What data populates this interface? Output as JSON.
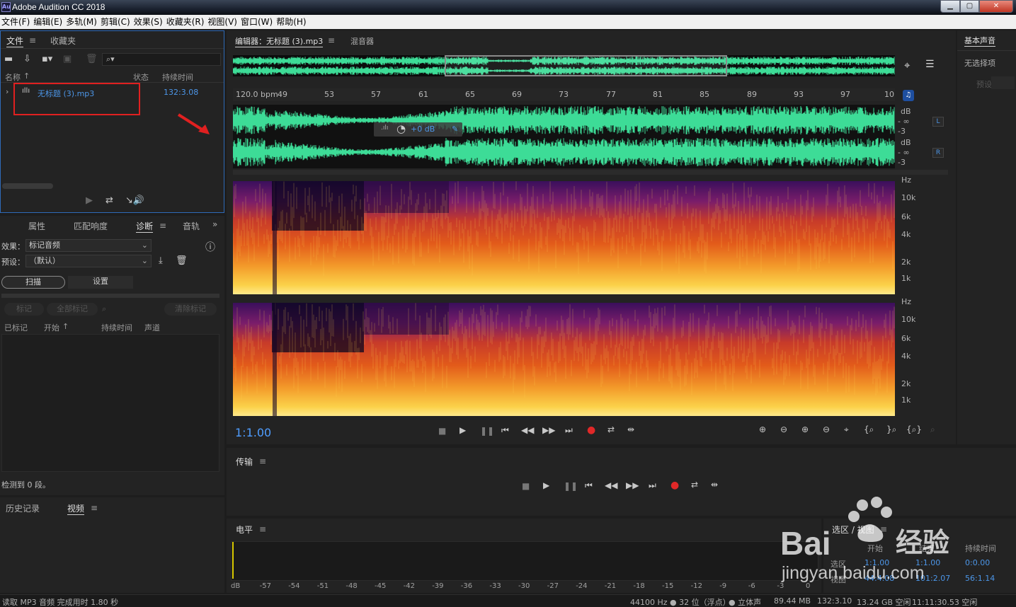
{
  "window": {
    "title": "Adobe Audition CC 2018",
    "logo": "Au"
  },
  "menu": [
    "文件(F)",
    "编辑(E)",
    "多轨(M)",
    "剪辑(C)",
    "效果(S)",
    "收藏夹(R)",
    "视图(V)",
    "窗口(W)",
    "帮助(H)"
  ],
  "files_panel": {
    "tabs": [
      "文件",
      "收藏夹"
    ],
    "columns": {
      "name": "名称",
      "status": "状态",
      "duration": "持续时间"
    },
    "file": {
      "name": "无标题 (3).mp3",
      "duration": "132:3.08"
    }
  },
  "diag_panel": {
    "tabs": [
      "属性",
      "匹配响度",
      "诊断",
      "音轨"
    ],
    "effect_label": "效果：",
    "effect_value": "标记音频",
    "preset_label": "预设：",
    "preset_value": "（默认）",
    "scan_btn": "扫描",
    "settings_btn": "设置",
    "mark_btn": "标记",
    "mark_all_btn": "全部标记",
    "clear_marks_btn": "清除标记",
    "cols": [
      "已标记",
      "开始",
      "持续时间",
      "声道"
    ],
    "detected": "检测到 0 段。"
  },
  "hist_panel": {
    "tabs": [
      "历史记录",
      "视频"
    ]
  },
  "editor": {
    "tab_editor": "编辑器：无标题 (3).mp3",
    "tab_mixer": "混音器",
    "bpm": "120.0 bpm",
    "ruler": [
      "49",
      "53",
      "57",
      "61",
      "65",
      "69",
      "73",
      "77",
      "81",
      "85",
      "89",
      "93",
      "97",
      "10"
    ],
    "hud_gain": "+0 dB",
    "db": "dB",
    "db_inf": "- ∞",
    "db_m3": "-3",
    "ch_l": "L",
    "ch_r": "R",
    "hz": "Hz",
    "freqs": [
      "10k",
      "6k",
      "4k",
      "2k",
      "1k"
    ],
    "timecode": "1:1.00"
  },
  "right_panel": {
    "title": "基本声音",
    "none": "无选择项",
    "preset": "预设："
  },
  "transport": {
    "title": "传输"
  },
  "level": {
    "title": "电平",
    "scale": [
      "dB",
      "-57",
      "-54",
      "-51",
      "-48",
      "-45",
      "-42",
      "-39",
      "-36",
      "-33",
      "-30",
      "-27",
      "-24",
      "-21",
      "-18",
      "-15",
      "-12",
      "-9",
      "-6",
      "-3",
      "0"
    ]
  },
  "selection": {
    "title": "选区 / 视图",
    "col_start": "开始",
    "col_end": "结束",
    "col_dur": "持续时间",
    "row_sel": "选区",
    "row_view": "视图",
    "sel_start": "1:1.00",
    "sel_end": "1:1.00",
    "sel_dur": "0:0.00",
    "view_start": "44:4.08",
    "view_end": "101:2.07",
    "view_dur": "56:1.14"
  },
  "status": {
    "left": "读取 MP3 音频 完成用时 1.80 秒",
    "rate": "44100 Hz ● 32 位（浮点）",
    "channels": "● 立体声",
    "size": "89.44 MB",
    "dur": "132:3.10",
    "free": "13.24 GB 空闲",
    "free_time": "11:11:30.53 空闲"
  },
  "watermark": {
    "brand": "Bai",
    "brand2": "经验",
    "url": "jingyan.baidu.com"
  },
  "colors": {
    "wave": "#3ddc97",
    "accent": "#4c96e8",
    "record": "#e02828",
    "highlight": "#e02020"
  }
}
